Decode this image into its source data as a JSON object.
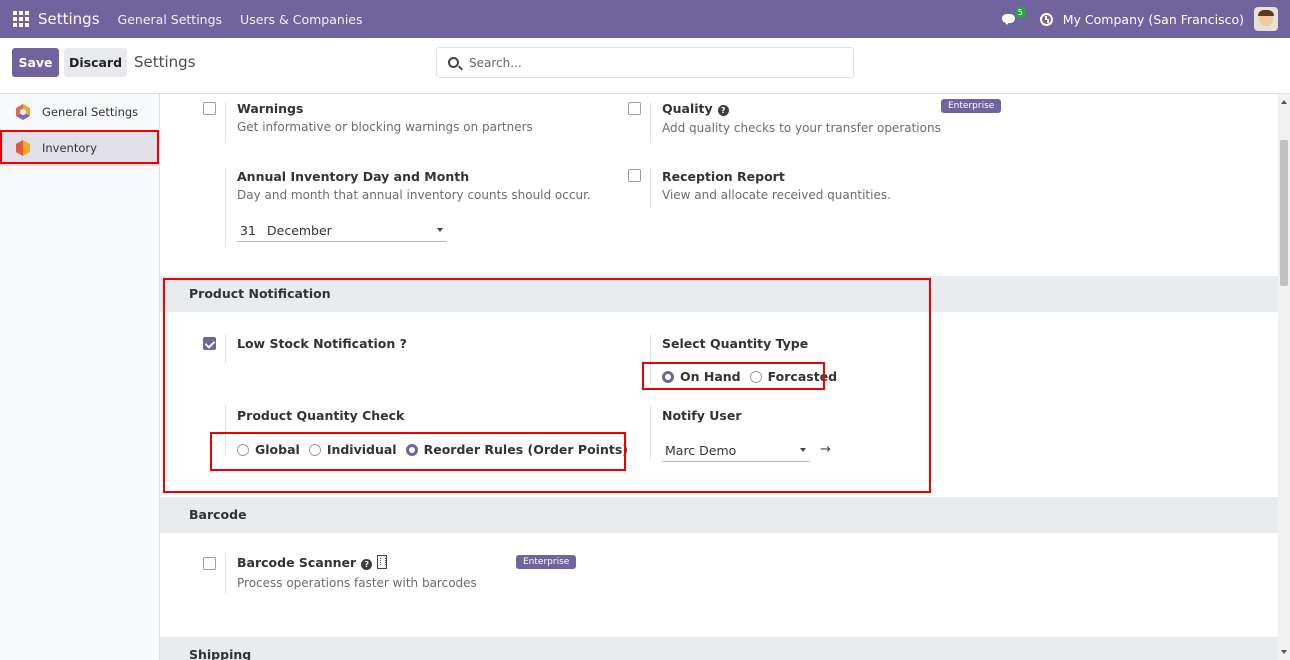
{
  "navbar": {
    "app_title": "Settings",
    "menu": [
      "General Settings",
      "Users & Companies"
    ],
    "chat_badge": "5",
    "company": "My Company (San Francisco)"
  },
  "control_panel": {
    "save_label": "Save",
    "discard_label": "Discard",
    "breadcrumb": "Settings",
    "search_placeholder": "Search..."
  },
  "sidebar": {
    "items": [
      {
        "label": "General Settings",
        "active": false
      },
      {
        "label": "Inventory",
        "active": true
      }
    ]
  },
  "settings_top": {
    "warnings": {
      "title": "Warnings",
      "desc": "Get informative or blocking warnings on partners",
      "checked": false
    },
    "quality": {
      "title": "Quality",
      "desc": "Add quality checks to your transfer operations",
      "badge": "Enterprise",
      "checked": false
    },
    "annual_inventory": {
      "title": "Annual Inventory Day and Month",
      "desc": "Day and month that annual inventory counts should occur.",
      "day": "31",
      "month": "December"
    },
    "reception_report": {
      "title": "Reception Report",
      "desc": "View and allocate received quantities.",
      "checked": false
    }
  },
  "product_notification": {
    "section_title": "Product Notification",
    "low_stock_label": "Low Stock Notification ?",
    "low_stock_checked": true,
    "select_quantity_type": {
      "label": "Select Quantity Type",
      "options": [
        "On Hand",
        "Forcasted"
      ],
      "selected": "On Hand"
    },
    "product_quantity_check": {
      "label": "Product Quantity Check",
      "options": [
        "Global",
        "Individual",
        "Reorder Rules (Order Points)"
      ],
      "selected": "Reorder Rules (Order Points)"
    },
    "notify_user": {
      "label": "Notify User",
      "value": "Marc Demo"
    }
  },
  "barcode": {
    "section_title": "Barcode",
    "scanner_title": "Barcode Scanner",
    "scanner_desc": "Process operations faster with barcodes",
    "badge": "Enterprise",
    "checked": false
  },
  "shipping": {
    "section_title": "Shipping"
  },
  "colors": {
    "brand": "#71639e",
    "highlight": "#ee0000",
    "section_bg": "#e9ecef"
  }
}
